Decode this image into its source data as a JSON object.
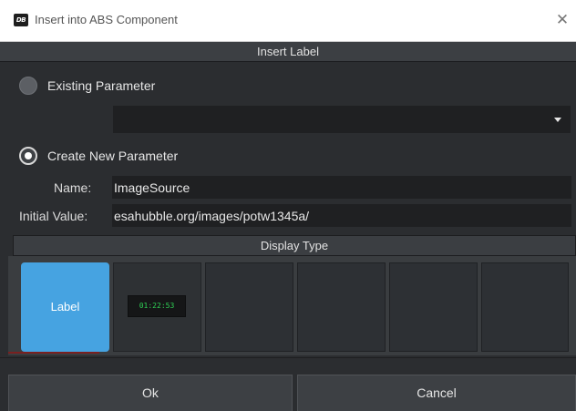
{
  "window": {
    "app_icon_text": "DB",
    "title": "Insert into ABS Component",
    "close_glyph": "✕"
  },
  "section": {
    "title": "Insert Label"
  },
  "existing": {
    "label": "Existing Parameter",
    "checked": false,
    "dropdown_value": ""
  },
  "create_new": {
    "label": "Create New Parameter",
    "checked": true
  },
  "fields": {
    "name_label": "Name:",
    "name_value": "ImageSource",
    "initial_label": "Initial Value:",
    "initial_value": "esahubble.org/images/potw1345a/"
  },
  "display_type": {
    "title": "Display Type",
    "tiles": [
      {
        "label": "Label",
        "selected": true
      },
      {
        "clock_text": "01:22:53",
        "selected": false
      },
      {
        "label": "",
        "selected": false
      },
      {
        "label": "",
        "selected": false
      },
      {
        "label": "",
        "selected": false
      },
      {
        "label": "",
        "selected": false
      }
    ],
    "accent_color": "#46a3e1",
    "clock_color": "#2fd155"
  },
  "buttons": {
    "ok": "Ok",
    "cancel": "Cancel"
  },
  "icons": {
    "app": "dashboard-app-icon",
    "close": "close-icon",
    "dropdown": "chevron-down-icon"
  }
}
